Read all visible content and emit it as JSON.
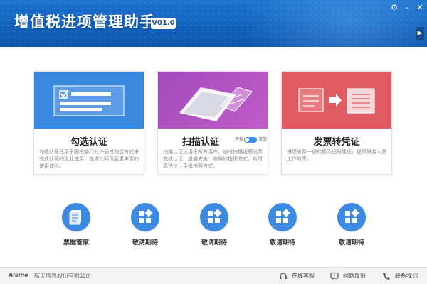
{
  "header": {
    "title": "增值税进项管理助手",
    "version": "V01.0",
    "accent": "#1565c0"
  },
  "cards": [
    {
      "title": "勾选认证",
      "description": "勾选认证适用于国税部门允许通过勾选方式来完成认证的企业使用，提供比网页版更丰富的使用体验。",
      "banner_color": "#3a87e0",
      "icon": "checklist-icon"
    },
    {
      "title": "扫描认证",
      "description": "扫描认证适用于所有用户，通过扫描纸质发票完成认证，是最安全、准确的抵扣方式。新增高拍仪，手机拍照方式。",
      "banner_color": "#b050c0",
      "icon": "scanner-icon",
      "toggle": {
        "left": "平板",
        "right": "滚筒"
      }
    },
    {
      "title": "发票转凭证",
      "description": "进项发票一键转换为记账凭证，提高财务人员工作效率。",
      "banner_color": "#e05a63",
      "icon": "invoice-to-voucher-icon"
    }
  ],
  "features": [
    {
      "label": "票据管家",
      "icon": "ticket-manager-icon"
    },
    {
      "label": "敬请期待",
      "icon": "apps-icon"
    },
    {
      "label": "敬请期待",
      "icon": "apps-icon"
    },
    {
      "label": "敬请期待",
      "icon": "apps-icon"
    },
    {
      "label": "敬请期待",
      "icon": "apps-icon"
    }
  ],
  "footer": {
    "logo": "Aisino",
    "company": "航天信息股份有限公司",
    "links": [
      {
        "label": "在线客服",
        "icon": "headset-icon"
      },
      {
        "label": "问题反馈",
        "icon": "feedback-icon"
      },
      {
        "label": "联系我们",
        "icon": "phone-icon"
      }
    ]
  }
}
